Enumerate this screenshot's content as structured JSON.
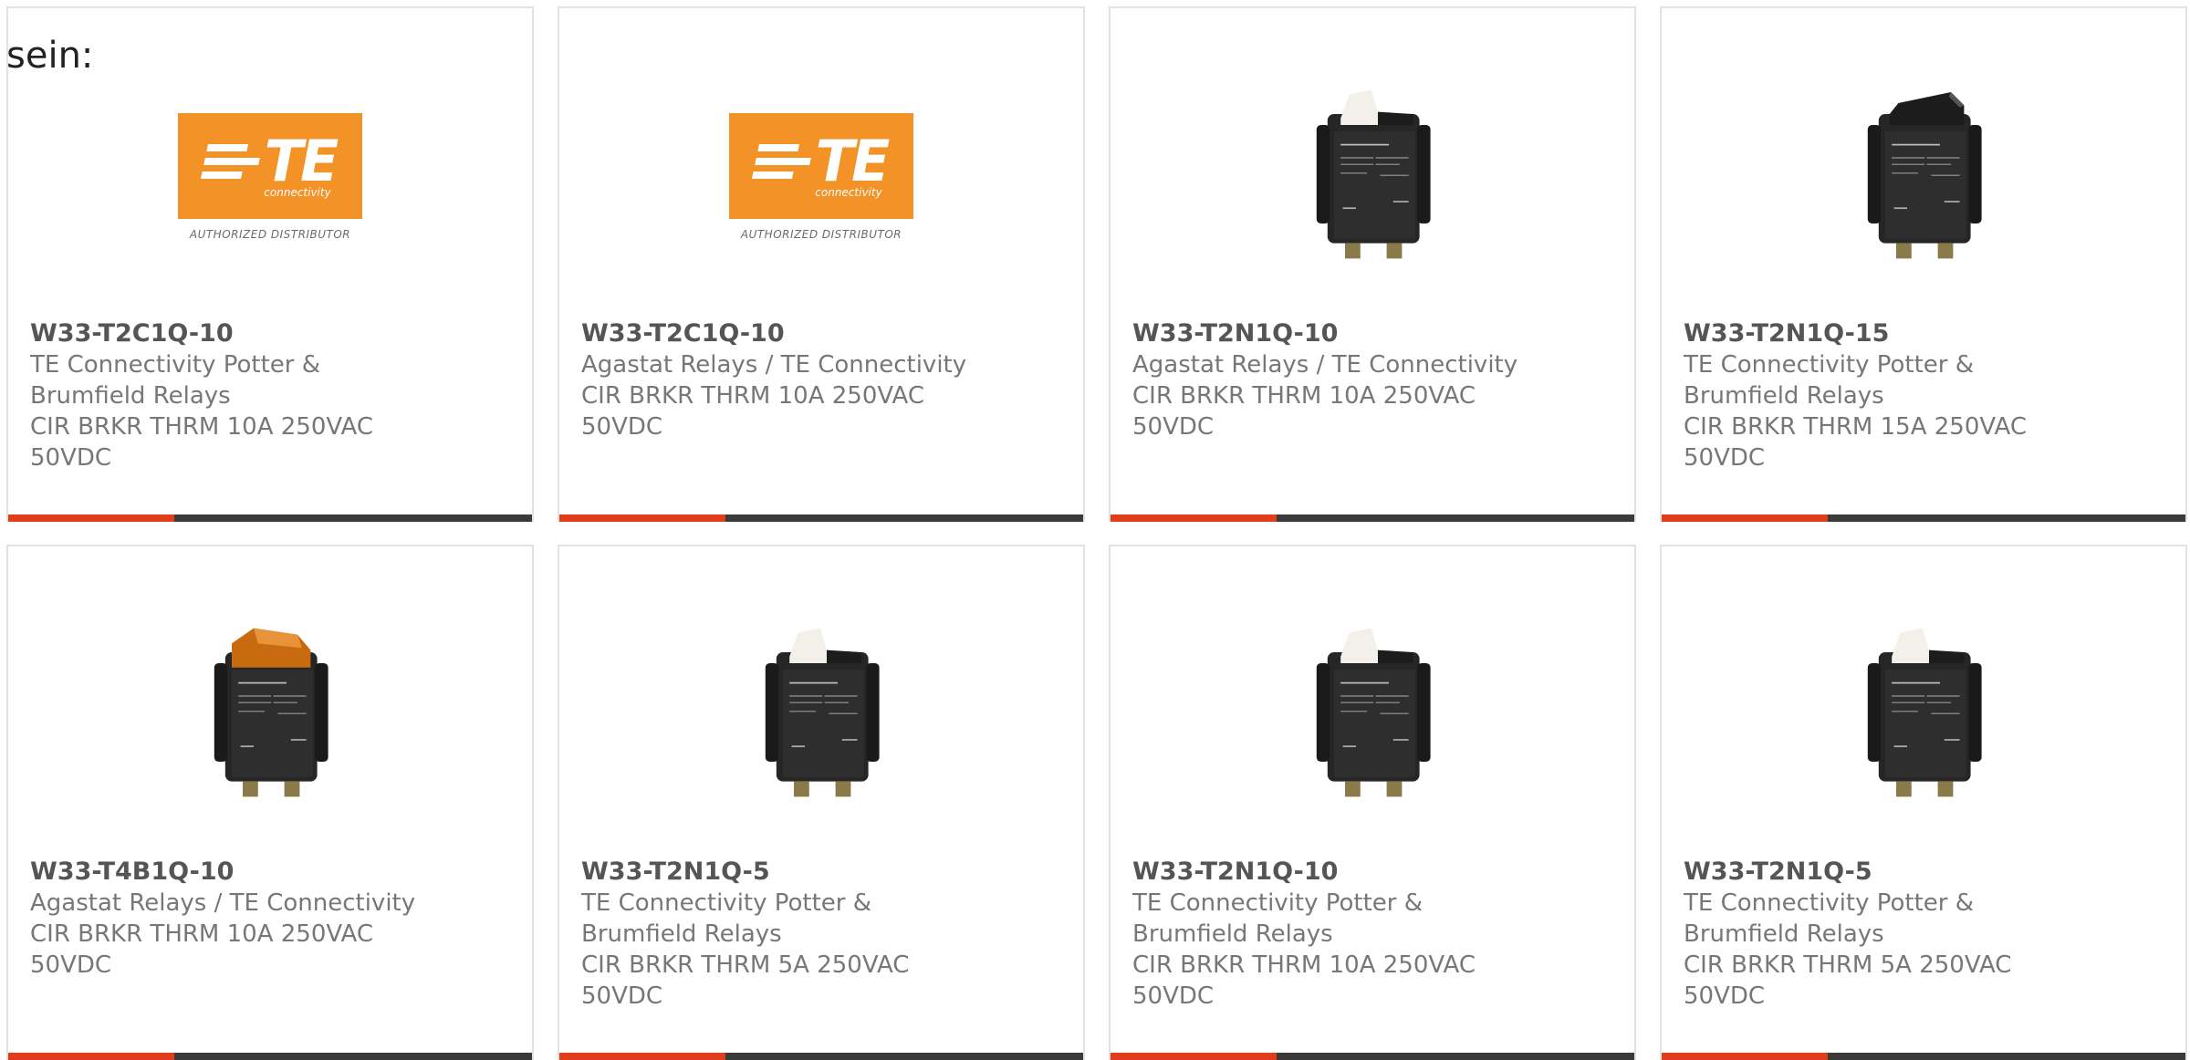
{
  "intro_text": "sein:",
  "logo": {
    "wordmark": "TE",
    "subtitle": "connectivity",
    "tagline": "AUTHORIZED DISTRIBUTOR",
    "color": "#f39226"
  },
  "accent_color": "#e03e1a",
  "products": [
    {
      "part": "W33-T2C1Q-10",
      "mfr": [
        "TE Connectivity Potter &",
        "Brumfield Relays"
      ],
      "desc": [
        "CIR BRKR THRM 10A 250VAC",
        "50VDC"
      ],
      "image": "te-logo"
    },
    {
      "part": "W33-T2C1Q-10",
      "mfr": [
        "Agastat Relays / TE Connectivity"
      ],
      "desc": [
        "CIR BRKR THRM 10A 250VAC",
        "50VDC"
      ],
      "image": "te-logo"
    },
    {
      "part": "W33-T2N1Q-10",
      "mfr": [
        "Agastat Relays / TE Connectivity"
      ],
      "desc": [
        "CIR BRKR THRM 10A 250VAC",
        "50VDC"
      ],
      "image": "rocker-white"
    },
    {
      "part": "W33-T2N1Q-15",
      "mfr": [
        "TE Connectivity Potter &",
        "Brumfield Relays"
      ],
      "desc": [
        "CIR BRKR THRM 15A 250VAC",
        "50VDC"
      ],
      "image": "rocker-black"
    },
    {
      "part": "W33-T4B1Q-10",
      "mfr": [
        "Agastat Relays / TE Connectivity"
      ],
      "desc": [
        "CIR BRKR THRM 10A 250VAC",
        "50VDC"
      ],
      "image": "rocker-amber"
    },
    {
      "part": "W33-T2N1Q-5",
      "mfr": [
        "TE Connectivity Potter &",
        "Brumfield Relays"
      ],
      "desc": [
        "CIR BRKR THRM 5A 250VAC",
        "50VDC"
      ],
      "image": "rocker-white"
    },
    {
      "part": "W33-T2N1Q-10",
      "mfr": [
        "TE Connectivity Potter &",
        "Brumfield Relays"
      ],
      "desc": [
        "CIR BRKR THRM 10A 250VAC",
        "50VDC"
      ],
      "image": "rocker-white"
    },
    {
      "part": "W33-T2N1Q-5",
      "mfr": [
        "TE Connectivity Potter &",
        "Brumfield Relays"
      ],
      "desc": [
        "CIR BRKR THRM 5A 250VAC",
        "50VDC"
      ],
      "image": "rocker-white"
    }
  ]
}
